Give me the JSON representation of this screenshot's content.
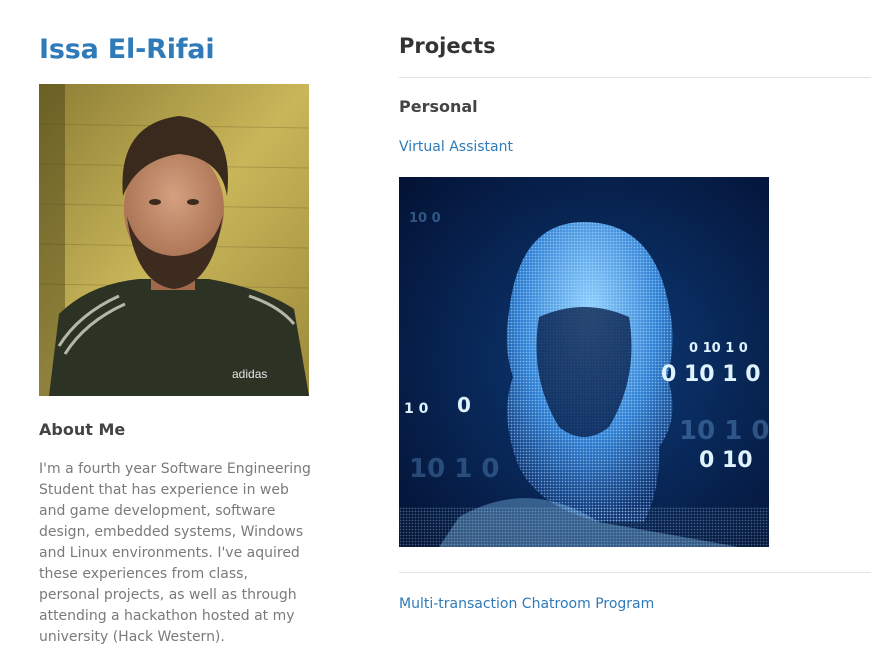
{
  "site": {
    "title": "Issa El-Rifai"
  },
  "profile": {
    "photo_shirt_text": "adidas",
    "about_heading": "About Me",
    "about_text": "I'm a fourth year Software Engineering Student that has experience in web and game development, software design, embedded systems, Windows and Linux environments. I've aquired these experiences from class, personal projects, as well as through attending a hackathon hosted at my university (Hack Western)."
  },
  "projects": {
    "heading": "Projects",
    "section": "Personal",
    "items": [
      {
        "title": "Virtual Assistant"
      },
      {
        "title": "Multi-transaction Chatroom Program"
      }
    ]
  },
  "colors": {
    "accent": "#2f7ab8",
    "heading": "#444444",
    "body_text": "#7a7a7a",
    "divider": "#e2e2e2"
  },
  "icons": {
    "profile_photo": "person-photo",
    "project_image": "digital-head-image"
  }
}
